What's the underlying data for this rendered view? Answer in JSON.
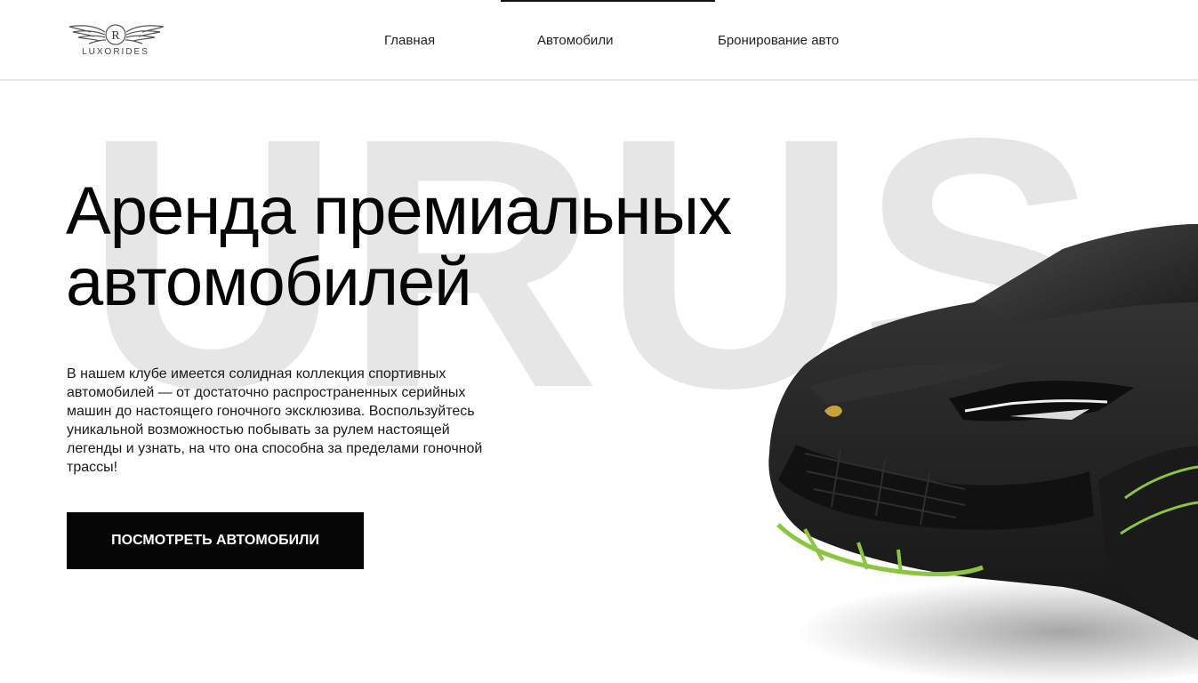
{
  "brand": {
    "logo_text": "LUXORIDES",
    "logo_letter": "R"
  },
  "nav": {
    "items": [
      {
        "label": "Главная"
      },
      {
        "label": "Автомобили"
      },
      {
        "label": "Бронирование авто"
      }
    ]
  },
  "hero": {
    "background_word": "URUS",
    "title": "Аренда премиальных автомобилей",
    "description": "В нашем клубе имеется солидная коллекция спортивных автомобилей — от достаточно распространенных серийных машин до настоящего гоночного эксклюзива. Воспользуйтесь уникальной возможностью побывать за рулем настоящей легенды и узнать, на что она способна за пределами гоночной трассы!",
    "cta_label": "ПОСМОТРЕТЬ АВТОМОБИЛИ"
  },
  "colors": {
    "background": "#ffffff",
    "text": "#050505",
    "button_bg": "#050505",
    "button_text": "#ffffff",
    "watermark": "#e6e6e6",
    "car_body": "#2a2a2a",
    "car_accent": "#8cc63f"
  },
  "icons": {
    "logo": "winged-r-logo-icon",
    "car": "lamborghini-urus-car-image"
  }
}
